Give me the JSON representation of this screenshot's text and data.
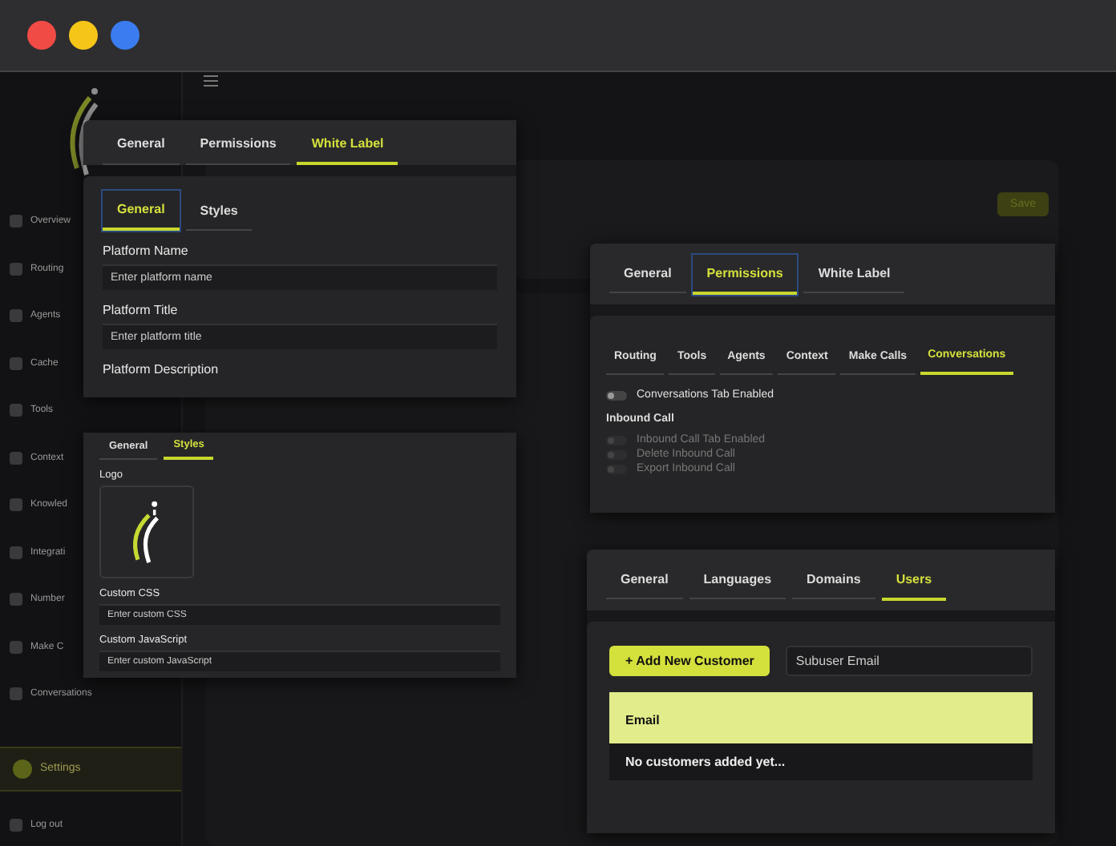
{
  "window": {
    "controls": [
      {
        "color": "#f04b45"
      },
      {
        "color": "#f5c518"
      },
      {
        "color": "#3b7df0"
      }
    ]
  },
  "background_app": {
    "sidebar": [
      {
        "label": "Overview",
        "selected": false
      },
      {
        "label": "Routing",
        "selected": false
      },
      {
        "label": "Agents",
        "selected": false
      },
      {
        "label": "Cache",
        "selected": false
      },
      {
        "label": "Tools",
        "selected": false
      },
      {
        "label": "Context",
        "selected": false
      },
      {
        "label": "Knowled",
        "selected": false
      },
      {
        "label": "Integrati",
        "selected": false
      },
      {
        "label": "Number",
        "selected": false
      },
      {
        "label": "Make C",
        "selected": false
      },
      {
        "label": "Conversations",
        "selected": false
      },
      {
        "label": "Settings",
        "selected": true
      }
    ],
    "logout": "Log out",
    "save_button": "Save"
  },
  "white_label_panel": {
    "tabs": [
      {
        "label": "General",
        "selected": false
      },
      {
        "label": "Permissions",
        "selected": false
      },
      {
        "label": "White Label",
        "selected": true
      }
    ],
    "subtabs": [
      {
        "label": "General",
        "selected": true
      },
      {
        "label": "Styles",
        "selected": false
      }
    ],
    "fields": [
      {
        "label": "Platform Name",
        "placeholder": "Enter platform name"
      },
      {
        "label": "Platform Title",
        "placeholder": "Enter platform title"
      }
    ],
    "next_label": "Platform Description"
  },
  "styles_panel": {
    "tabs": [
      {
        "label": "General",
        "selected": false
      },
      {
        "label": "Styles",
        "selected": true
      }
    ],
    "logo_label": "Logo",
    "fields": [
      {
        "label": "Custom CSS",
        "placeholder": "Enter custom CSS"
      },
      {
        "label": "Custom JavaScript",
        "placeholder": "Enter custom JavaScript"
      }
    ]
  },
  "permissions_panel": {
    "tabs": [
      {
        "label": "General",
        "selected": false
      },
      {
        "label": "Permissions",
        "selected": true
      },
      {
        "label": "White Label",
        "selected": false
      }
    ],
    "subtabs": [
      {
        "label": "Routing",
        "selected": false
      },
      {
        "label": "Tools",
        "selected": false
      },
      {
        "label": "Agents",
        "selected": false
      },
      {
        "label": "Context",
        "selected": false
      },
      {
        "label": "Make Calls",
        "selected": false
      },
      {
        "label": "Conversations",
        "selected": true
      }
    ],
    "main_toggle": {
      "label": "Conversations Tab Enabled",
      "on": false,
      "disabled": false
    },
    "section_title": "Inbound Call",
    "toggles": [
      {
        "label": "Inbound Call Tab Enabled",
        "on": false,
        "disabled": true
      },
      {
        "label": "Delete Inbound Call",
        "on": false,
        "disabled": true
      },
      {
        "label": "Export Inbound Call",
        "on": false,
        "disabled": true
      }
    ]
  },
  "users_panel": {
    "tabs": [
      {
        "label": "General",
        "selected": false
      },
      {
        "label": "Languages",
        "selected": false
      },
      {
        "label": "Domains",
        "selected": false
      },
      {
        "label": "Users",
        "selected": true
      }
    ],
    "add_button": "+ Add New Customer",
    "search": {
      "placeholder": "Subuser Email"
    },
    "table": {
      "columns": [
        "Email"
      ],
      "empty_text": "No customers added yet..."
    }
  }
}
